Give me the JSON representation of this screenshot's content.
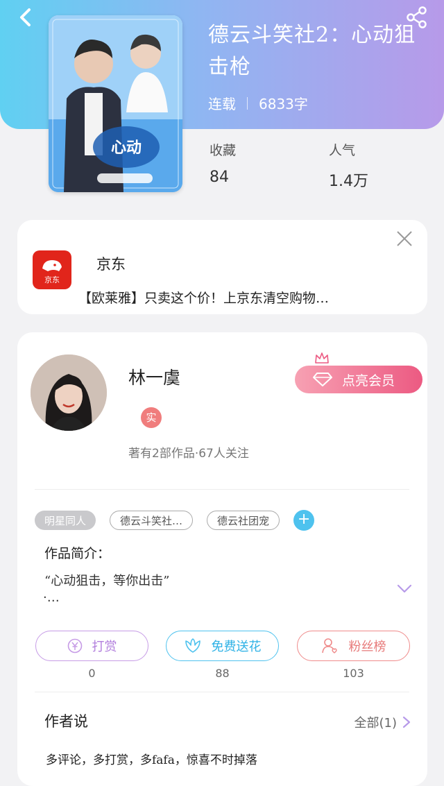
{
  "book": {
    "title": "德云斗笑社2：心动狙击枪",
    "status": "连载",
    "word_count": "6833字",
    "favorites_label": "收藏",
    "favorites_value": "84",
    "popularity_label": "人气",
    "popularity_value": "1.4万"
  },
  "ad": {
    "app_name": "京东",
    "logo_text": "京东",
    "description": "【欧莱雅】只卖这个价！上京东清空购物…"
  },
  "author": {
    "name": "林一虞",
    "badge": "实",
    "meta": "著有2部作品·67人关注",
    "vip_button": "点亮会员"
  },
  "tags": [
    "明星同人",
    "德云斗笑社…",
    "德云社团宠"
  ],
  "intro": {
    "title": "作品简介：",
    "text": "“心动狙击，等你出击”",
    "more": "·…"
  },
  "actions": [
    {
      "label": "打赏",
      "count": "0",
      "color": "#c69be6"
    },
    {
      "label": "免费送花",
      "count": "88",
      "color": "#4ec2ee"
    },
    {
      "label": "粉丝榜",
      "count": "103",
      "color": "#ef8a8a"
    }
  ],
  "author_says": {
    "title": "作者说",
    "all_link": "全部(1)",
    "text": "多评论，多打赏，多fafa，惊喜不时掉落"
  },
  "icons": [
    "back-icon",
    "share-icon",
    "close-icon",
    "crown-icon",
    "diamond-icon",
    "plus-icon",
    "chevron-down-icon",
    "yen-icon",
    "flower-icon",
    "fan-icon",
    "chevron-right-icon"
  ]
}
